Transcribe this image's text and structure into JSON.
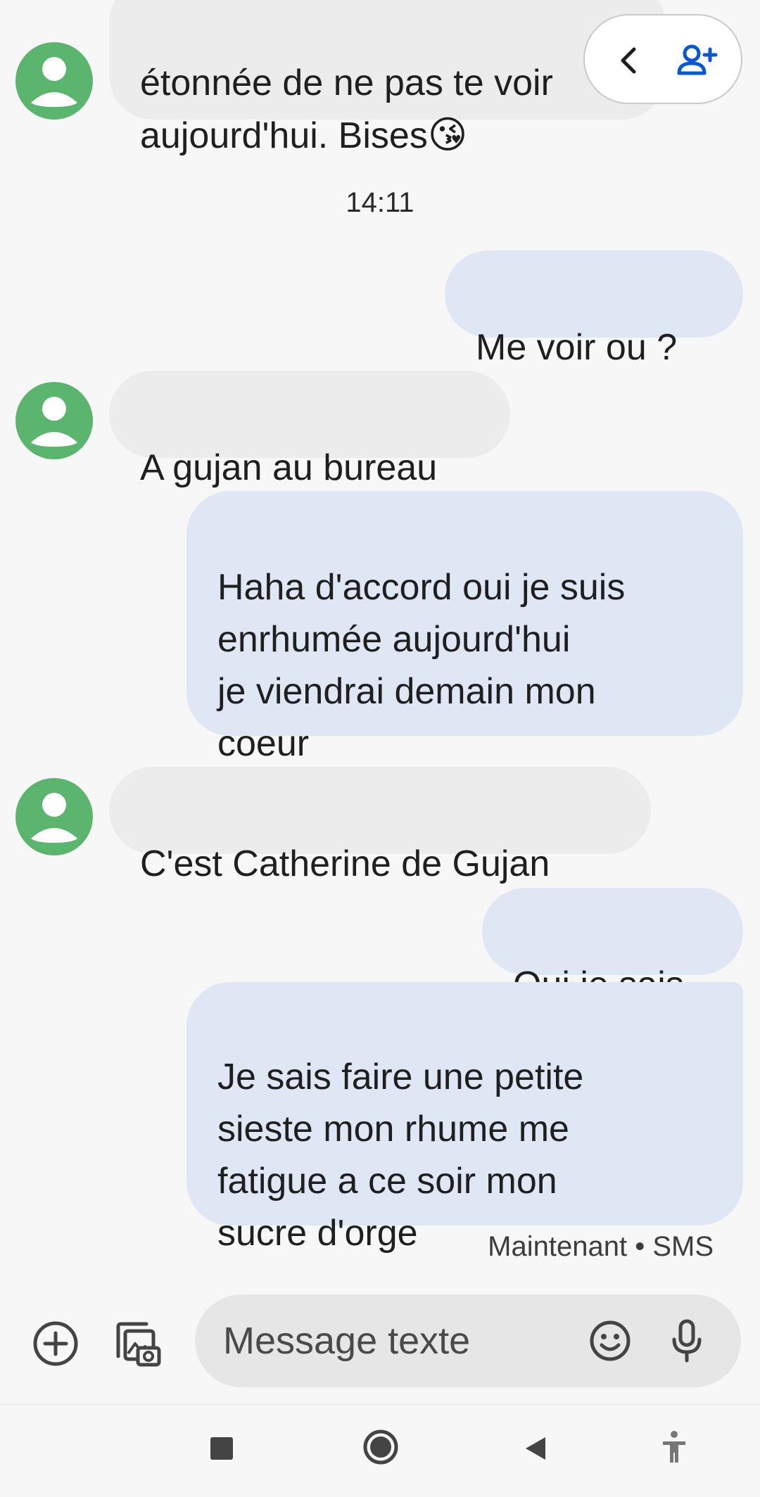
{
  "messages": [
    {
      "direction": "incoming",
      "text": "étonnée de ne pas te voir\naujourd'hui. Bises",
      "emoji": "😘"
    },
    {
      "direction": "outgoing",
      "text": "Me voir ou ?"
    },
    {
      "direction": "incoming",
      "text": "A gujan au bureau"
    },
    {
      "direction": "outgoing",
      "text": "Haha d'accord oui je suis\nenrhumée aujourd'hui\nje viendrai demain mon\ncoeur"
    },
    {
      "direction": "incoming",
      "text": "C'est Catherine de Gujan"
    },
    {
      "direction": "outgoing",
      "text": "Oui je sais"
    },
    {
      "direction": "outgoing",
      "text": "Je sais faire une petite\nsieste mon rhume me\nfatigue a ce soir mon\nsucre d'orge"
    }
  ],
  "timestamp": "14:11",
  "last_message_meta": "Maintenant • SMS",
  "compose": {
    "placeholder": "Message texte"
  },
  "icons": {
    "header": [
      "chevron-left-icon",
      "add-contact-icon"
    ],
    "compose": [
      "add-circle-icon",
      "gallery-icon",
      "emoji-icon",
      "microphone-icon"
    ],
    "navbar": [
      "recents-square-icon",
      "home-circle-icon",
      "back-triangle-icon",
      "accessibility-icon"
    ]
  },
  "colors": {
    "background": "#f7f7f8",
    "incoming_bubble": "#ececec",
    "outgoing_bubble": "#dfe7f5",
    "avatar": "#5cb56f",
    "accent_blue": "#0b57d0"
  }
}
